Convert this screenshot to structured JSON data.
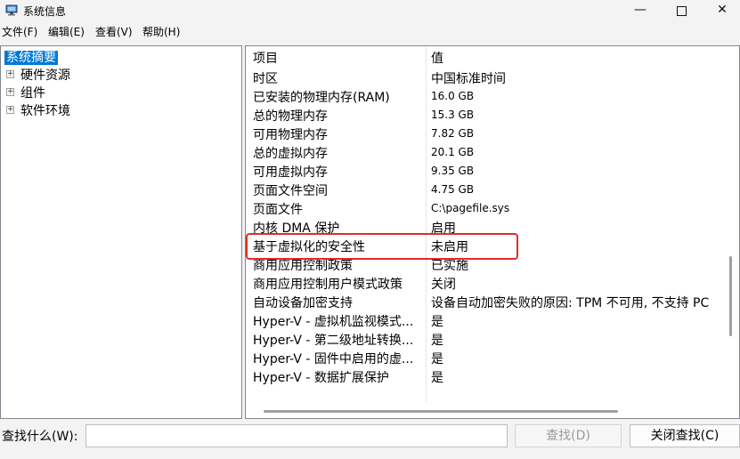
{
  "window": {
    "title": "系统信息",
    "minimize_glyph": "—",
    "close_glyph": "✕"
  },
  "menu": [
    {
      "label": "文件(F)"
    },
    {
      "label": "编辑(E)"
    },
    {
      "label": "查看(V)"
    },
    {
      "label": "帮助(H)"
    }
  ],
  "tree": {
    "root": "系统摘要",
    "expander_glyph": "+",
    "children": [
      {
        "label": "硬件资源"
      },
      {
        "label": "组件"
      },
      {
        "label": "软件环境"
      }
    ]
  },
  "list": {
    "columns": {
      "item": "项目",
      "value": "值"
    },
    "rows": [
      {
        "item": "时区",
        "value": "中国标准时间"
      },
      {
        "item": "已安装的物理内存(RAM)",
        "value": "16.0 GB"
      },
      {
        "item": "总的物理内存",
        "value": "15.3 GB"
      },
      {
        "item": "可用物理内存",
        "value": "7.82 GB"
      },
      {
        "item": "总的虚拟内存",
        "value": "20.1 GB"
      },
      {
        "item": "可用虚拟内存",
        "value": "9.35 GB"
      },
      {
        "item": "页面文件空间",
        "value": "4.75 GB"
      },
      {
        "item": "页面文件",
        "value": "C:\\pagefile.sys"
      },
      {
        "item": "内核 DMA 保护",
        "value": "启用"
      },
      {
        "item": "基于虚拟化的安全性",
        "value": "未启用"
      },
      {
        "item": "商用应用控制政策",
        "value": "已实施"
      },
      {
        "item": "商用应用控制用户模式政策",
        "value": "关闭"
      },
      {
        "item": "自动设备加密支持",
        "value": "设备自动加密失败的原因: TPM 不可用, 不支持 PC"
      },
      {
        "item": "Hyper-V - 虚拟机监视模式...",
        "value": "是"
      },
      {
        "item": "Hyper-V - 第二级地址转换...",
        "value": "是"
      },
      {
        "item": "Hyper-V - 固件中启用的虚...",
        "value": "是"
      },
      {
        "item": "Hyper-V - 数据扩展保护",
        "value": "是"
      }
    ]
  },
  "find": {
    "label": "查找什么(W):",
    "input_value": "",
    "find_button": "查找(D)",
    "close_button": "关闭查找(C)"
  }
}
